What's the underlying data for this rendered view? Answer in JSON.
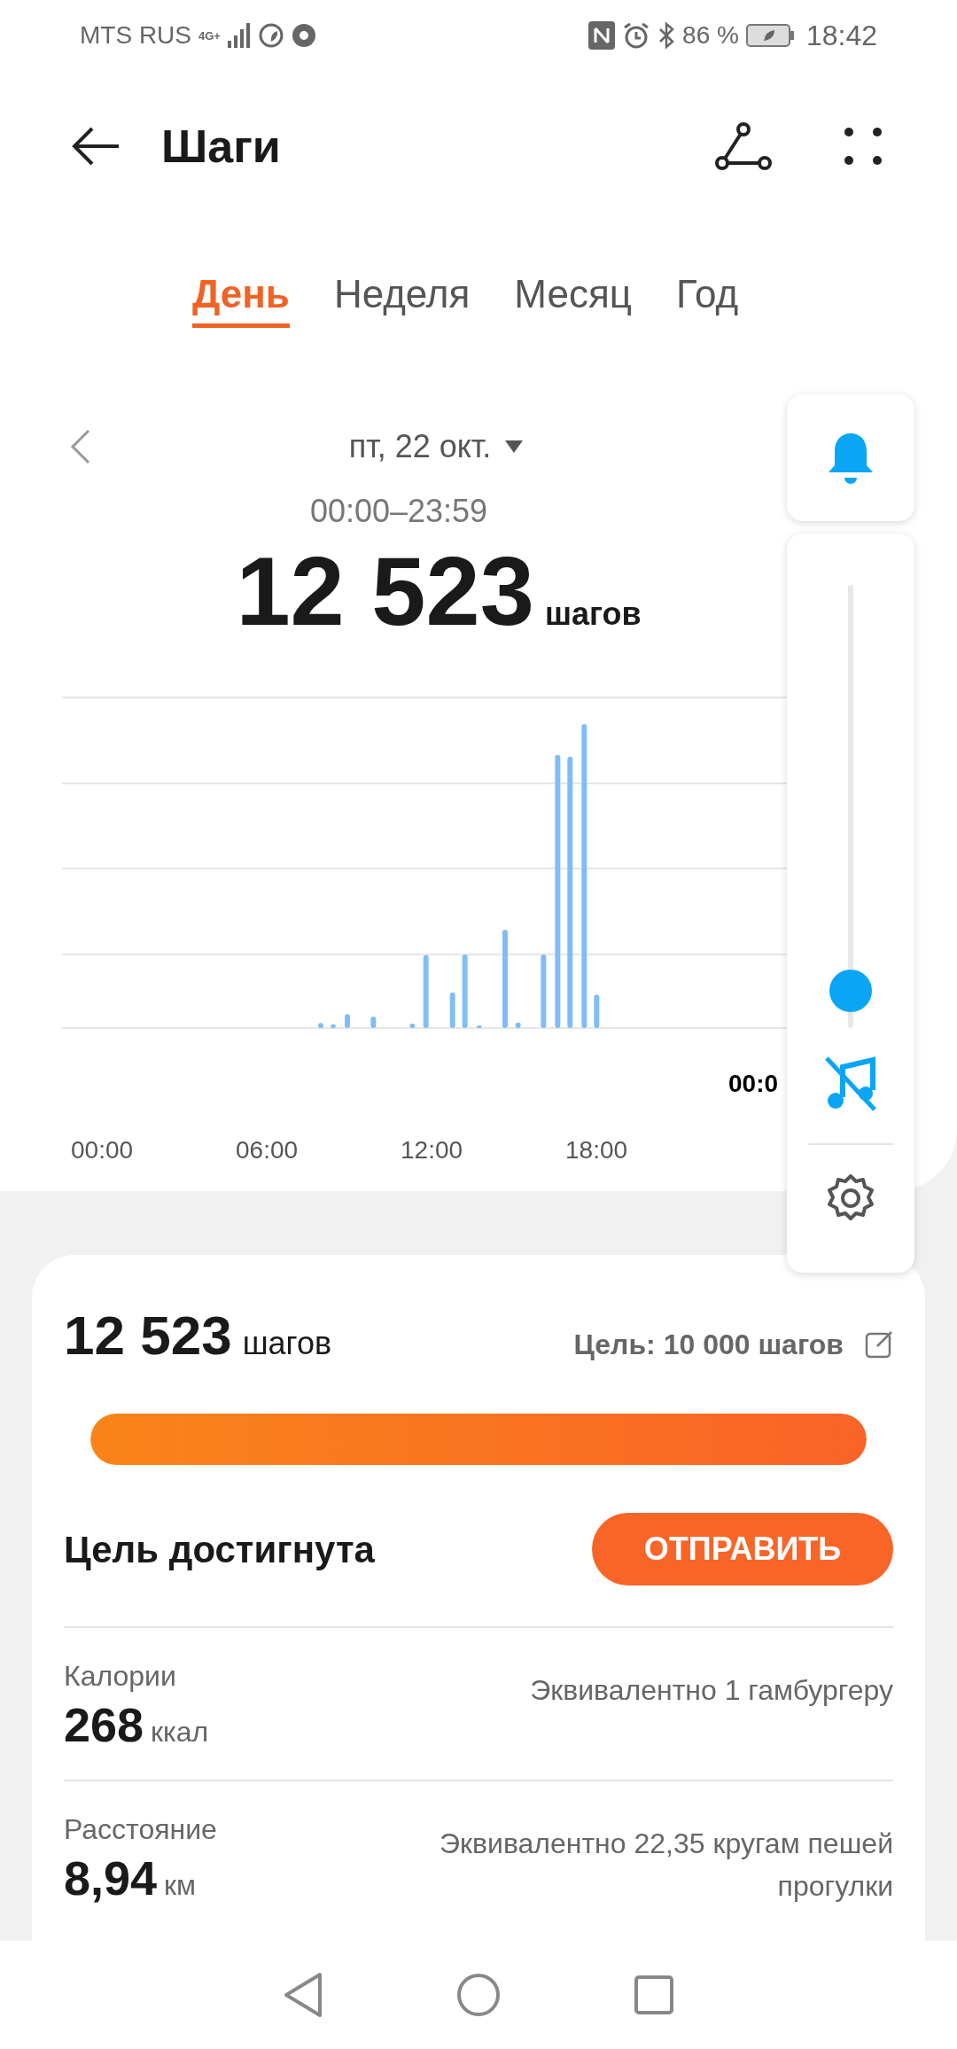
{
  "status_bar": {
    "carrier": "MTS RUS",
    "network": "4G+",
    "battery": "86 %",
    "time": "18:42"
  },
  "header": {
    "title": "Шаги"
  },
  "tabs": [
    {
      "label": "День",
      "selected": true
    },
    {
      "label": "Неделя",
      "selected": false
    },
    {
      "label": "Месяц",
      "selected": false
    },
    {
      "label": "Год",
      "selected": false
    }
  ],
  "day": {
    "date": "пт, 22 окт.",
    "range": "00:00–23:59",
    "steps": "12 523",
    "unit": "шагов"
  },
  "chart": {
    "x_labels": [
      "00:00",
      "06:00",
      "12:00",
      "18:00"
    ],
    "end_label": "00:0"
  },
  "volume_panel": {
    "level": 0.04
  },
  "summary": {
    "steps": "12 523",
    "unit": "шагов",
    "goal": "Цель: 10 000 шагов",
    "level": 1,
    "status": "Цель достигнута",
    "button": "ОТПРАВИТЬ"
  },
  "stats": [
    {
      "label": "Калории",
      "value": "268",
      "unit": "ккал",
      "note": "Эквивалентно 1 гамбургеру"
    },
    {
      "label": "Расстояние",
      "value": "8,94",
      "unit": "км",
      "note": "Эквивалентно 22,35 кругам пешей прогулки"
    }
  ]
}
